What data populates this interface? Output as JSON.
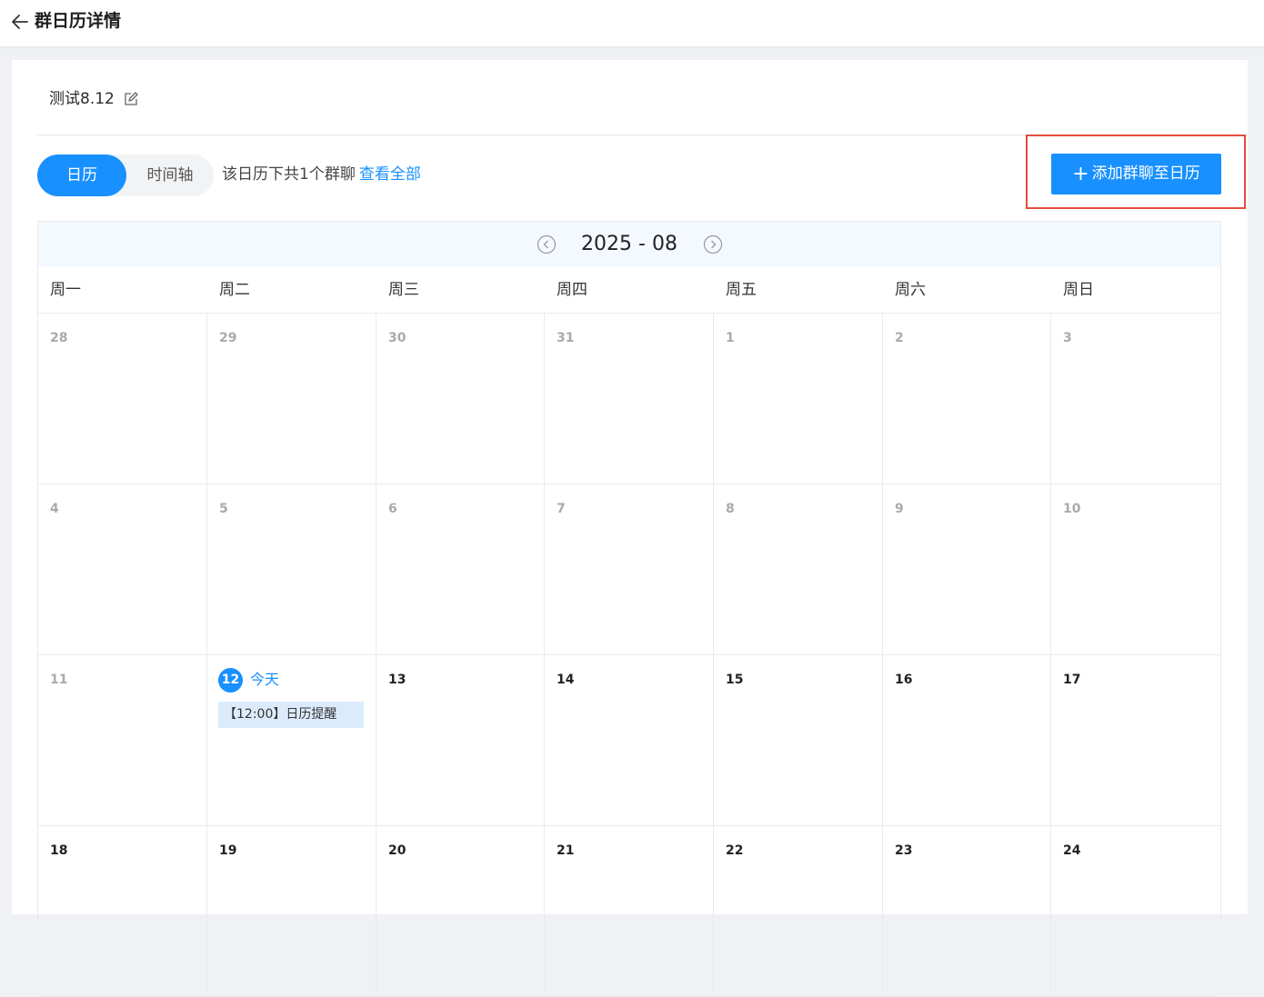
{
  "header": {
    "title": "群日历详情",
    "back_icon": "arrow-left-icon"
  },
  "calendar_info": {
    "name": "测试8.12",
    "edit_icon": "edit-icon"
  },
  "toolbar": {
    "tabs": [
      {
        "label": "日历",
        "active": true
      },
      {
        "label": "时间轴",
        "active": false
      }
    ],
    "info_text": "该日历下共1个群聊",
    "view_all_link": "查看全部",
    "add_button": {
      "icon": "plus-icon",
      "label": "添加群聊至日历"
    }
  },
  "calendar": {
    "month_label": "2025 - 08",
    "prev_icon": "chevron-left-circle-icon",
    "next_icon": "chevron-right-circle-icon",
    "weekdays": [
      "周一",
      "周二",
      "周三",
      "周四",
      "周五",
      "周六",
      "周日"
    ],
    "weeks": [
      [
        {
          "day": "28",
          "muted": true
        },
        {
          "day": "29",
          "muted": true
        },
        {
          "day": "30",
          "muted": true
        },
        {
          "day": "31",
          "muted": true
        },
        {
          "day": "1",
          "muted": true
        },
        {
          "day": "2",
          "muted": true
        },
        {
          "day": "3",
          "muted": true
        }
      ],
      [
        {
          "day": "4",
          "muted": true
        },
        {
          "day": "5",
          "muted": true
        },
        {
          "day": "6",
          "muted": true
        },
        {
          "day": "7",
          "muted": true
        },
        {
          "day": "8",
          "muted": true
        },
        {
          "day": "9",
          "muted": true
        },
        {
          "day": "10",
          "muted": true
        }
      ],
      [
        {
          "day": "11",
          "muted": true
        },
        {
          "day": "12",
          "today": true,
          "today_label": "今天",
          "events": [
            "【12:00】日历提醒"
          ]
        },
        {
          "day": "13"
        },
        {
          "day": "14"
        },
        {
          "day": "15"
        },
        {
          "day": "16"
        },
        {
          "day": "17"
        }
      ],
      [
        {
          "day": "18"
        },
        {
          "day": "19"
        },
        {
          "day": "20"
        },
        {
          "day": "21"
        },
        {
          "day": "22"
        },
        {
          "day": "23"
        },
        {
          "day": "24"
        }
      ]
    ]
  },
  "colors": {
    "accent": "#1890ff",
    "highlight_border": "#e54a3c",
    "event_bg": "#dcebfc"
  }
}
